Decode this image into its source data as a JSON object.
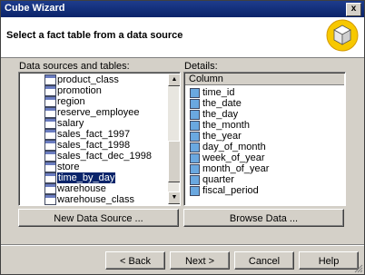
{
  "window": {
    "title": "Cube Wizard",
    "close_label": "x"
  },
  "header": {
    "heading": "Select a fact table from a data source"
  },
  "sources": {
    "label": "Data sources and tables:",
    "items": [
      "product_class",
      "promotion",
      "region",
      "reserve_employee",
      "salary",
      "sales_fact_1997",
      "sales_fact_1998",
      "sales_fact_dec_1998",
      "store",
      "time_by_day",
      "warehouse",
      "warehouse_class"
    ],
    "selected": "time_by_day"
  },
  "details": {
    "label": "Details:",
    "column_header": "Column",
    "columns": [
      "time_id",
      "the_date",
      "the_day",
      "the_month",
      "the_year",
      "day_of_month",
      "week_of_year",
      "month_of_year",
      "quarter",
      "fiscal_period"
    ]
  },
  "buttons": {
    "new_data_source": "New Data Source ...",
    "browse_data": "Browse Data ...",
    "back": "< Back",
    "next": "Next >",
    "cancel": "Cancel",
    "help": "Help"
  }
}
